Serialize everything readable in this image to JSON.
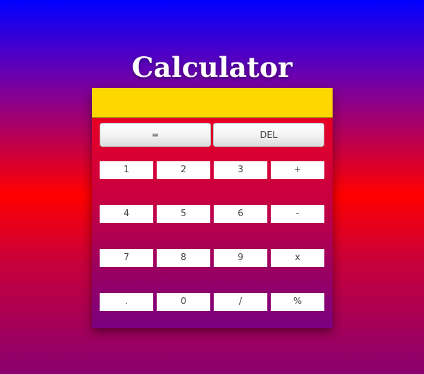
{
  "header": {
    "title": "Calculator"
  },
  "display": {
    "value": ""
  },
  "top_buttons": {
    "equals": "=",
    "delete": "DEL"
  },
  "keypad": {
    "rows": [
      [
        "1",
        "2",
        "3",
        "+"
      ],
      [
        "4",
        "5",
        "6",
        "-"
      ],
      [
        "7",
        "8",
        "9",
        "x"
      ],
      [
        ".",
        "0",
        "/",
        "%"
      ]
    ]
  },
  "colors": {
    "display_background": "#ffd700",
    "gradient_top": "#0000ff",
    "gradient_middle": "#ff0000",
    "gradient_bottom": "#8a0070"
  }
}
